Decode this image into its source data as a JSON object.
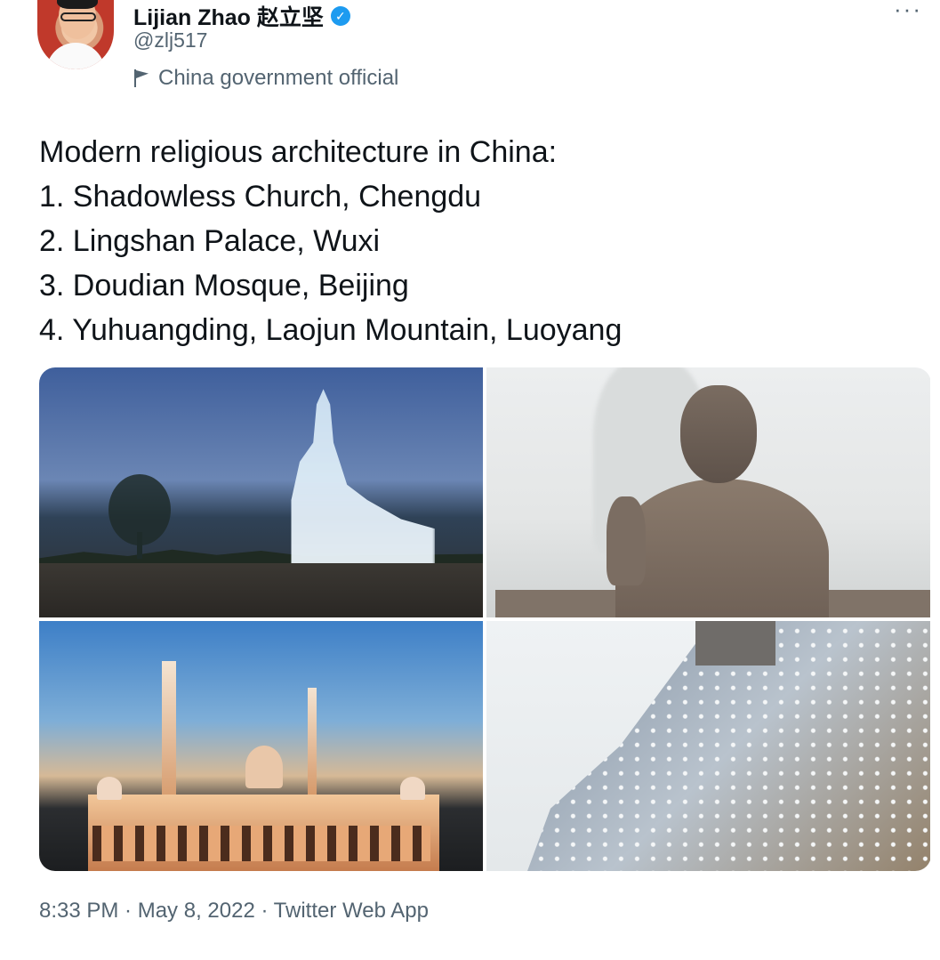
{
  "author": {
    "display_name": "Lijian Zhao 赵立坚",
    "handle": "@zlj517",
    "label": "China government official",
    "avatar_icon": "profile-photo"
  },
  "more_icon": "···",
  "verified_icon": "✓",
  "tweet": {
    "lines": [
      "Modern religious architecture in China:",
      "1. Shadowless Church, Chengdu",
      "2. Lingshan Palace, Wuxi",
      "3. Doudian Mosque, Beijing",
      "4. Yuhuangding, Laojun Mountain, Luoyang"
    ]
  },
  "footer": {
    "meta": "8:33 PM · May 8, 2022 · Twitter Web App"
  },
  "colors": {
    "text": "#0f1419",
    "secondary": "#536471",
    "verified": "#1d9bf0"
  }
}
